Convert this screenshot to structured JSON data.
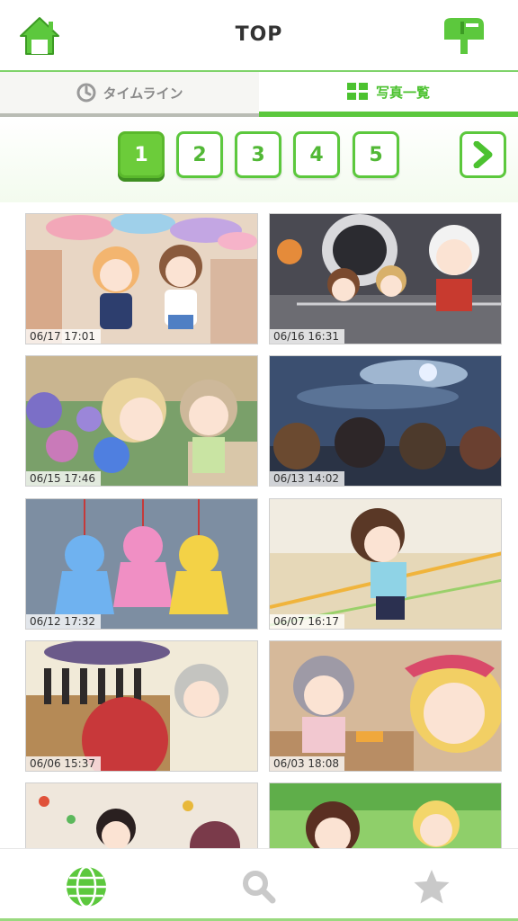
{
  "header": {
    "title": "TOP",
    "home_icon": "home-icon",
    "mail_icon": "mailbox-icon",
    "accent": "#5cc83d"
  },
  "tabs": [
    {
      "label": "タイムライン",
      "icon": "clock-icon",
      "active": false
    },
    {
      "label": "写真一覧",
      "icon": "grid-icon",
      "active": true
    }
  ],
  "pagination": {
    "pages": [
      "1",
      "2",
      "3",
      "4",
      "5"
    ],
    "current": "1",
    "next_icon": "chevron-right-icon"
  },
  "photos": [
    {
      "date": "06/17 17:01",
      "scene": "umbrellas-street"
    },
    {
      "date": "06/16 16:31",
      "scene": "stage-crowd"
    },
    {
      "date": "06/15 17:46",
      "scene": "hydrangea-garden"
    },
    {
      "date": "06/13 14:02",
      "scene": "night-sky"
    },
    {
      "date": "06/12 17:32",
      "scene": "teddy-charms"
    },
    {
      "date": "06/07 16:17",
      "scene": "gym-court"
    },
    {
      "date": "06/06 15:37",
      "scene": "parasol-shop"
    },
    {
      "date": "06/03 18:08",
      "scene": "cafe-selfie"
    },
    {
      "date": "",
      "scene": "climbing-wall"
    },
    {
      "date": "",
      "scene": "park-friends"
    }
  ],
  "bottom_nav": [
    {
      "name": "globe-icon",
      "active": true
    },
    {
      "name": "search-icon",
      "active": false
    },
    {
      "name": "star-icon",
      "active": false
    }
  ]
}
